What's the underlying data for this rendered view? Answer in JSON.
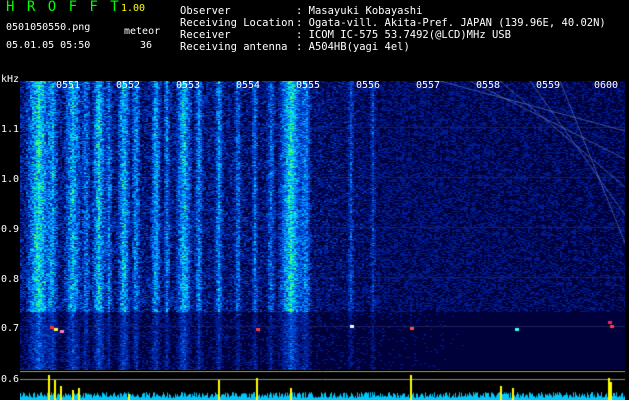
{
  "app": {
    "name": "H R O F F T",
    "version": "1.00"
  },
  "file": {
    "name": "0501050550.png",
    "mode": "meteor",
    "datetime": "05.01.05 05:50",
    "count": "36"
  },
  "info": [
    {
      "key": "Observer",
      "value": ": Masayuki Kobayashi"
    },
    {
      "key": "Receiving Location",
      "value": ": Ogata-vill. Akita-Pref. JAPAN (139.96E, 40.02N)"
    },
    {
      "key": "Receiver",
      "value": ": ICOM IC-575 53.7492(@LCD)MHz USB"
    },
    {
      "key": "Receiving antenna",
      "value": ": A504HB(yagi 4el)"
    }
  ],
  "axis": {
    "unit": "kHz",
    "ticks": [
      "1.1",
      "1.0",
      "0.9",
      "0.8",
      "0.7",
      "0.6"
    ],
    "times": [
      "0551",
      "0552",
      "0553",
      "0554",
      "0555",
      "0556",
      "0557",
      "0558",
      "0559",
      "0600"
    ]
  },
  "colors": {
    "header_green": "#00ff00",
    "version_yellow": "#ffff00",
    "bg": "#000000",
    "spectro_bg": "#00003a",
    "activity_yellow": "#ffff00",
    "activity_cyan": "#00c8ff"
  }
}
